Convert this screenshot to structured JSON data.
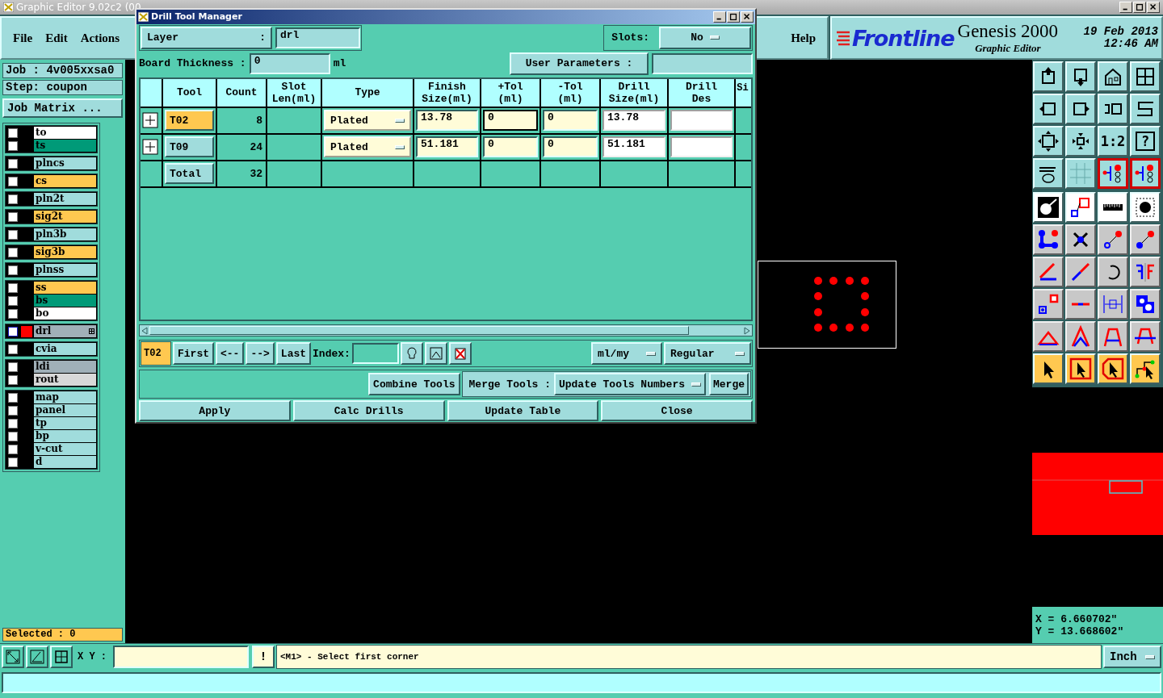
{
  "window": {
    "title": "Graphic Editor 9.02c2 (00"
  },
  "menu": [
    "File",
    "Edit",
    "Actions"
  ],
  "help": "Help",
  "brand": {
    "logo": "Frontline",
    "product": "Genesis 2000",
    "subtitle": "Graphic Editor",
    "date": "19 Feb 2013",
    "time": "12:46 AM"
  },
  "job": {
    "job": "Job : 4v005xxsa0",
    "step": "Step: coupon",
    "matrix_button": "Job Matrix ..."
  },
  "layer_groups": [
    [
      {
        "name": "to",
        "color": "#ffffff",
        "checked": false,
        "selected": false
      },
      {
        "name": "ts",
        "color": "#009a78",
        "checked": false,
        "selected": false
      }
    ],
    [
      {
        "name": "plncs",
        "color": "#a0dcdc",
        "checked": false,
        "selected": false
      }
    ],
    [
      {
        "name": "cs",
        "color": "#ffc850",
        "checked": false,
        "selected": false
      }
    ],
    [
      {
        "name": "pln2t",
        "color": "#a0dcdc",
        "checked": false,
        "selected": false
      }
    ],
    [
      {
        "name": "sig2t",
        "color": "#ffc850",
        "checked": false,
        "selected": false
      }
    ],
    [
      {
        "name": "pln3b",
        "color": "#a0dcdc",
        "checked": false,
        "selected": false
      }
    ],
    [
      {
        "name": "sig3b",
        "color": "#ffc850",
        "checked": false,
        "selected": false
      }
    ],
    [
      {
        "name": "plnss",
        "color": "#a0dcdc",
        "checked": false,
        "selected": false
      }
    ],
    [
      {
        "name": "ss",
        "color": "#ffc850",
        "checked": false,
        "selected": false
      },
      {
        "name": "bs",
        "color": "#009a78",
        "checked": false,
        "selected": false
      },
      {
        "name": "bo",
        "color": "#ffffff",
        "checked": false,
        "selected": false
      }
    ],
    [
      {
        "name": "drl",
        "color": "#a0b0b8",
        "checked": false,
        "selected": true
      }
    ],
    [
      {
        "name": "cvia",
        "color": "#a0dcdc",
        "checked": false,
        "selected": false
      }
    ],
    [
      {
        "name": "ldi",
        "color": "#a0b0b8",
        "checked": false,
        "selected": false
      },
      {
        "name": "rout",
        "color": "#d8d8d8",
        "checked": false,
        "selected": false
      }
    ],
    [
      {
        "name": "map",
        "color": "#a0dcdc",
        "checked": false,
        "selected": false
      },
      {
        "name": "panel",
        "color": "#a0dcdc",
        "checked": false,
        "selected": false
      },
      {
        "name": "tp",
        "color": "#a0dcdc",
        "checked": false,
        "selected": false
      },
      {
        "name": "bp",
        "color": "#a0dcdc",
        "checked": false,
        "selected": false
      },
      {
        "name": "v-cut",
        "color": "#a0dcdc",
        "checked": false,
        "selected": false
      },
      {
        "name": "d",
        "color": "#a0dcdc",
        "checked": false,
        "selected": false
      }
    ]
  ],
  "selected_count": "Selected : 0",
  "toolbox": {
    "zoom_ratio": "1:2",
    "help": "?"
  },
  "coordinates": {
    "x": "X = 6.660702\"",
    "y": "Y = 13.668602\""
  },
  "status": {
    "xy_label": "X Y :",
    "alert": "!",
    "message": "<M1> - Select first corner",
    "units": "Inch"
  },
  "dialog": {
    "title": "Drill Tool Manager",
    "layer": {
      "label": "Layer",
      "colon": ":",
      "value": "drl"
    },
    "slots": {
      "label": "Slots:",
      "value": "No"
    },
    "board_thickness": {
      "label": "Board Thickness :",
      "value": "0",
      "unit": "ml"
    },
    "user_parameters": {
      "label": "User Parameters :"
    },
    "columns": [
      "Tool",
      "Count",
      "Slot\nLen(ml)",
      "Type",
      "Finish\nSize(ml)",
      "+Tol\n(ml)",
      "-Tol\n(ml)",
      "Drill\nSize(ml)",
      "Drill\nDes",
      "Si"
    ],
    "rows": [
      {
        "tool": "T02",
        "selected": true,
        "count": "8",
        "type": "Plated",
        "finish_size": "13.78",
        "plus_tol": "0",
        "plus_tol_focused": true,
        "minus_tol": "0",
        "drill_size": "13.78"
      },
      {
        "tool": "T09",
        "selected": false,
        "count": "24",
        "type": "Plated",
        "finish_size": "51.181",
        "plus_tol": "0",
        "plus_tol_focused": false,
        "minus_tol": "0",
        "drill_size": "51.181"
      }
    ],
    "total": {
      "label": "Total",
      "count": "32"
    },
    "nav": {
      "current": "T02",
      "buttons": [
        "First",
        "<--",
        "-->",
        "Last"
      ],
      "index_label": "Index:",
      "units": "ml/my",
      "mode": "Regular"
    },
    "merge": {
      "combine": "Combine Tools",
      "label": "Merge Tools :",
      "option": "Update Tools Numbers",
      "button": "Merge"
    },
    "actions": [
      "Apply",
      "Calc Drills",
      "Update Table",
      "Close"
    ]
  }
}
